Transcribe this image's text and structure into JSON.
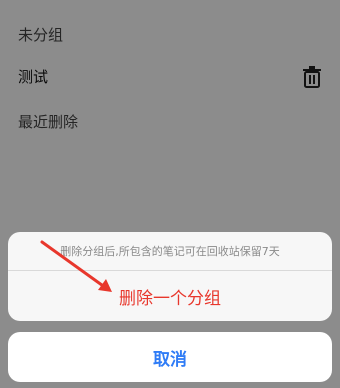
{
  "groups": [
    {
      "label": "未分组"
    },
    {
      "label": "测试"
    },
    {
      "label": "最近删除"
    }
  ],
  "action_sheet": {
    "message": "删除分组后,所包含的笔记可在回收站保留7天",
    "delete_label": "删除一个分组",
    "cancel_label": "取消"
  },
  "colors": {
    "destructive": "#e8372c",
    "cancel": "#2f7cf6",
    "annotation_arrow": "#e8372c"
  },
  "icons": {
    "trash": "trash-icon"
  }
}
